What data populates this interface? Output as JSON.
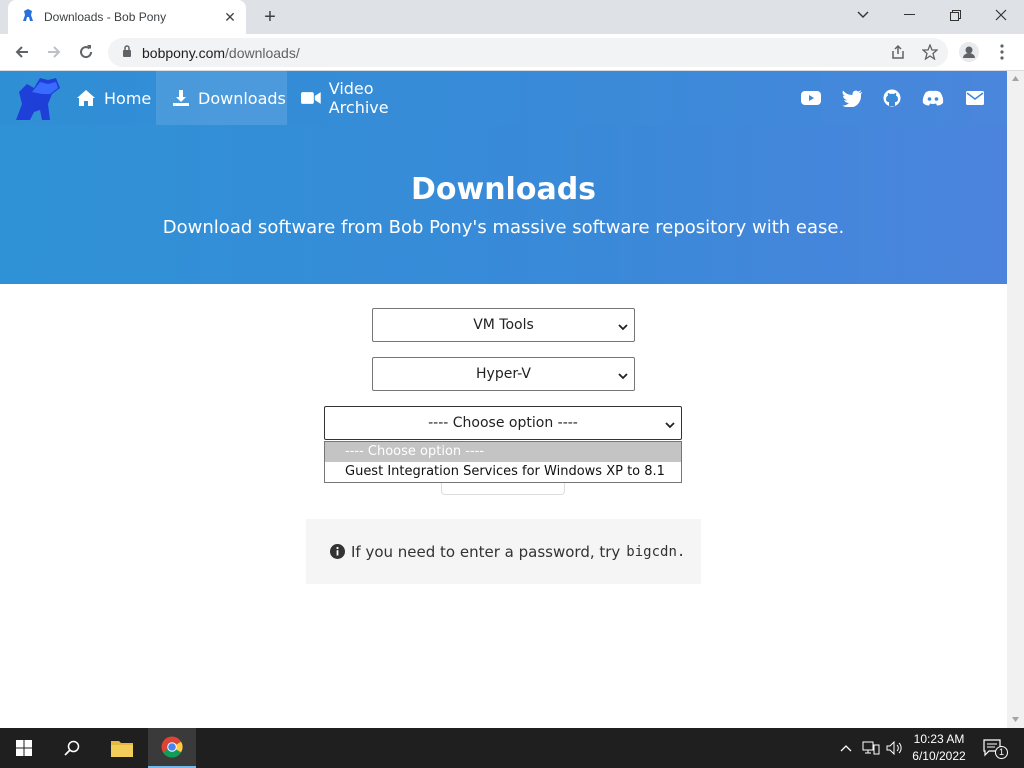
{
  "browser": {
    "tab_title": "Downloads - Bob Pony",
    "url_host": "bobpony.com",
    "url_path": "/downloads/"
  },
  "nav": {
    "home": "Home",
    "downloads": "Downloads",
    "video_archive": "Video Archive",
    "social_icons": [
      "youtube-icon",
      "twitter-icon",
      "github-icon",
      "discord-icon",
      "mail-icon"
    ]
  },
  "hero": {
    "title": "Downloads",
    "subtitle": "Download software from Bob Pony's massive software repository with ease."
  },
  "form": {
    "select1_value": "VM Tools",
    "select2_value": "Hyper-V",
    "select3_value": "---- Choose option ----",
    "dropdown_options": [
      "---- Choose option ----",
      "Guest Integration Services for Windows XP to 8.1"
    ]
  },
  "info": {
    "text": "If you need to enter a password, try",
    "password": "bigcdn."
  },
  "taskbar": {
    "time": "10:23 AM",
    "date": "6/10/2022",
    "notification_count": "1"
  },
  "colors": {
    "brand_blue": "#3a8ad8",
    "taskbar": "#1f1f1f"
  }
}
